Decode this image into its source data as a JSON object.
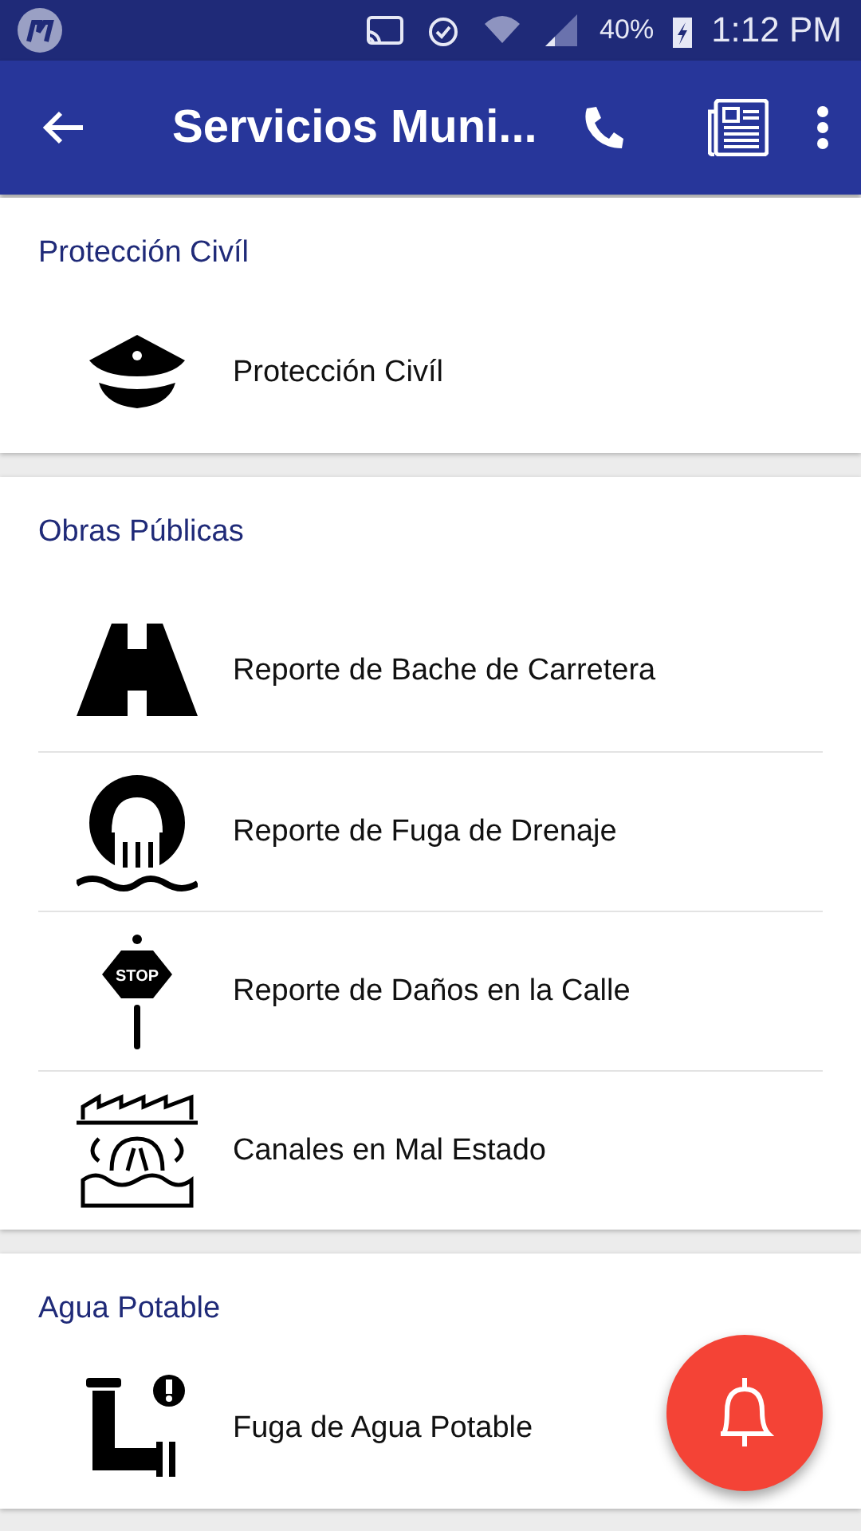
{
  "status_bar": {
    "battery": "40%",
    "time": "1:12 PM"
  },
  "app_bar": {
    "title": "Servicios Muni..."
  },
  "sections": [
    {
      "title": "Protección Civíl",
      "items": [
        {
          "label": "Protección Civíl"
        }
      ]
    },
    {
      "title": "Obras Públicas",
      "items": [
        {
          "label": "Reporte de Bache de Carretera"
        },
        {
          "label": "Reporte de Fuga de Drenaje"
        },
        {
          "label": "Reporte de Daños en la Calle",
          "sign_text": "STOP"
        },
        {
          "label": "Canales en Mal Estado"
        }
      ]
    },
    {
      "title": "Agua Potable",
      "items": [
        {
          "label": "Fuga de Agua Potable"
        }
      ]
    }
  ]
}
